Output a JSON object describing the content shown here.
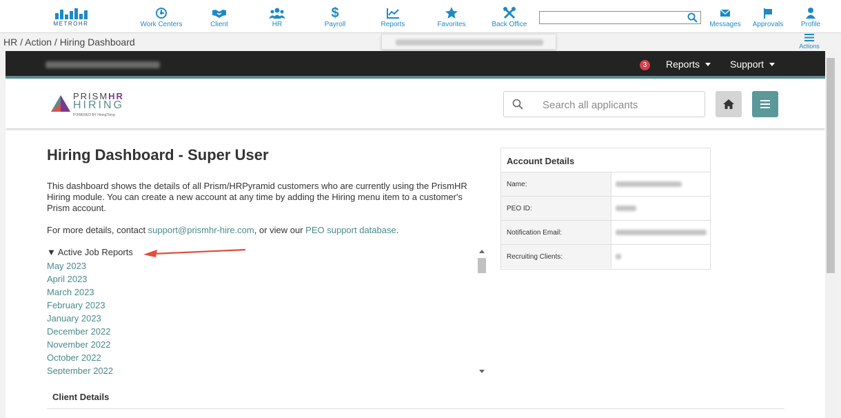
{
  "brand": {
    "logo_text": "METROHR"
  },
  "nav": {
    "items": [
      {
        "label": "Work Centers",
        "icon": "work-centers-icon"
      },
      {
        "label": "Client",
        "icon": "handshake-icon"
      },
      {
        "label": "HR",
        "icon": "people-icon"
      },
      {
        "label": "Payroll",
        "icon": "dollar-icon"
      },
      {
        "label": "Reports",
        "icon": "chart-line-icon"
      },
      {
        "label": "Favorites",
        "icon": "star-icon"
      },
      {
        "label": "Back Office",
        "icon": "tools-icon"
      }
    ],
    "search_value": "",
    "right_items": [
      {
        "label": "Messages",
        "icon": "envelope-icon"
      },
      {
        "label": "Approvals",
        "icon": "flag-icon"
      },
      {
        "label": "Profile",
        "icon": "user-icon"
      }
    ],
    "actions_label": "Actions"
  },
  "breadcrumb": "HR / Action / Hiring Dashboard",
  "app": {
    "notification_count": "3",
    "reports_label": "Reports",
    "support_label": "Support",
    "logo": {
      "line1_a": "PRISM",
      "line1_b": "HR",
      "line2": "HIRING",
      "line3": "POWERED BY HiringThing"
    },
    "search_placeholder": "Search all applicants"
  },
  "dashboard": {
    "title": "Hiring Dashboard - Super User",
    "intro": "This dashboard shows the details of all Prism/HRPyramid customers who are currently using the PrismHR Hiring module. You can create a new account at any time by adding the Hiring menu item to a customer's Prism account.",
    "contact_prefix": "For more details, contact ",
    "contact_email": "support@prismhr-hire.com",
    "contact_middle": ", or view our ",
    "contact_link": "PEO support database",
    "contact_suffix": ".",
    "reports_header": "Active Job Reports",
    "reports": [
      "May 2023",
      "April 2023",
      "March 2023",
      "February 2023",
      "January 2023",
      "December 2022",
      "November 2022",
      "October 2022",
      "September 2022"
    ],
    "client_details_label": "Client Details"
  },
  "account": {
    "title": "Account Details",
    "rows": [
      {
        "label": "Name:"
      },
      {
        "label": "PEO ID:"
      },
      {
        "label": "Notification Email:"
      },
      {
        "label": "Recruiting Clients:"
      }
    ]
  },
  "colors": {
    "nav_blue": "#1d8ac7",
    "teal": "#5a8b8d",
    "badge_red": "#d9404a",
    "dark_bar": "#232323"
  }
}
